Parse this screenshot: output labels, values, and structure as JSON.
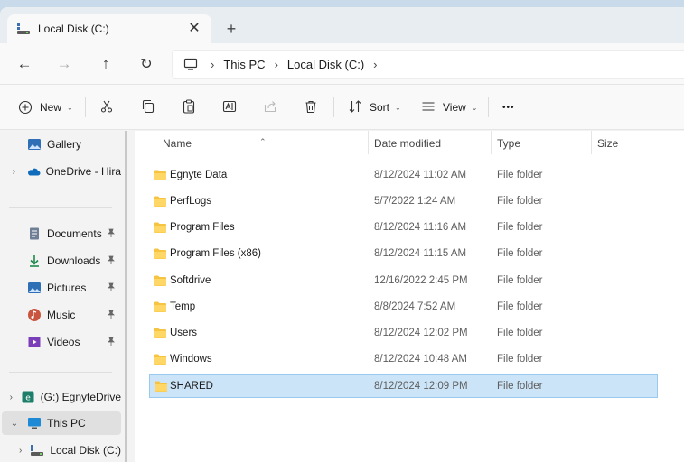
{
  "tab": {
    "title": "Local Disk (C:)",
    "close_glyph": "✕",
    "new_glyph": "+"
  },
  "nav": {
    "back_glyph": "←",
    "forward_glyph": "→",
    "up_glyph": "↑",
    "refresh_glyph": "↻",
    "breadcrumbs": [
      "This PC",
      "Local Disk (C:)"
    ],
    "separator": "›"
  },
  "commands": {
    "new_label": "New",
    "sort_label": "Sort",
    "view_label": "View",
    "more_glyph": "•••",
    "caret": "⌄"
  },
  "sidebar": {
    "items": [
      {
        "label": "Gallery",
        "icon": "gallery-icon"
      },
      {
        "label": "OneDrive - Hira",
        "icon": "onedrive-icon",
        "chevron": "›"
      },
      {
        "label": "Documents",
        "icon": "documents-icon",
        "pinned": true
      },
      {
        "label": "Downloads",
        "icon": "downloads-icon",
        "pinned": true
      },
      {
        "label": "Pictures",
        "icon": "pictures-icon",
        "pinned": true
      },
      {
        "label": "Music",
        "icon": "music-icon",
        "pinned": true
      },
      {
        "label": "Videos",
        "icon": "videos-icon",
        "pinned": true
      },
      {
        "label": "(G:) EgnyteDrive",
        "icon": "network-drive-icon",
        "chevron": "›"
      },
      {
        "label": "This PC",
        "icon": "this-pc-icon",
        "chevron": "⌄",
        "selected": true
      },
      {
        "label": "Local Disk (C:)",
        "icon": "local-disk-icon",
        "chevron": "›"
      }
    ],
    "pin_glyph": "📌"
  },
  "columns": {
    "name": "Name",
    "date": "Date modified",
    "type": "Type",
    "size": "Size",
    "sort_glyph": "⌃"
  },
  "files": [
    {
      "name": "Egnyte Data",
      "date": "8/12/2024 11:02 AM",
      "type": "File folder"
    },
    {
      "name": "PerfLogs",
      "date": "5/7/2022 1:24 AM",
      "type": "File folder"
    },
    {
      "name": "Program Files",
      "date": "8/12/2024 11:16 AM",
      "type": "File folder"
    },
    {
      "name": "Program Files (x86)",
      "date": "8/12/2024 11:15 AM",
      "type": "File folder"
    },
    {
      "name": "Softdrive",
      "date": "12/16/2022 2:45 PM",
      "type": "File folder"
    },
    {
      "name": "Temp",
      "date": "8/8/2024 7:52 AM",
      "type": "File folder"
    },
    {
      "name": "Users",
      "date": "8/12/2024 12:02 PM",
      "type": "File folder"
    },
    {
      "name": "Windows",
      "date": "8/12/2024 10:48 AM",
      "type": "File folder"
    },
    {
      "name": "SHARED",
      "date": "8/12/2024 12:09 PM",
      "type": "File folder",
      "selected": true
    }
  ],
  "colors": {
    "folder": "#f6c440",
    "selection": "#cce4f7",
    "accent": "#0067c0"
  }
}
